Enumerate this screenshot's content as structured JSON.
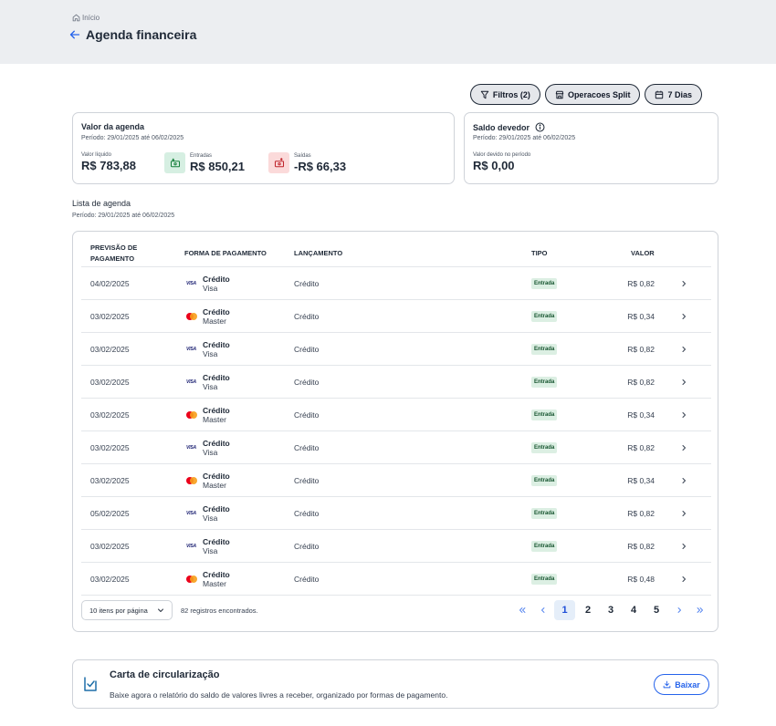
{
  "breadcrumb": {
    "label": "Início",
    "icon": "home-icon"
  },
  "page": {
    "title": "Agenda financeira"
  },
  "toolbar": {
    "filters_label": "Filtros (2)",
    "split_label": "Operacoes Split",
    "days_label": "7 Dias"
  },
  "agenda_card": {
    "title": "Valor da agenda",
    "period": "Período: 29/01/2025 até 06/02/2025",
    "liquido_label": "Valor líquido",
    "liquido_value": "R$ 783,88",
    "entradas_label": "Entradas",
    "entradas_value": "R$ 850,21",
    "saidas_label": "Saídas",
    "saidas_value": "-R$ 66,33"
  },
  "saldo_card": {
    "title": "Saldo devedor",
    "period": "Período: 29/01/2025 até 06/02/2025",
    "devido_label": "Valor devido no período",
    "devido_value": "R$ 0,00"
  },
  "list": {
    "title": "Lista de agenda",
    "period": "Período: 29/01/2025 até 06/02/2025"
  },
  "table": {
    "headers": {
      "previsao_1": "PREVISÃO DE",
      "previsao_2": "PAGAMENTO",
      "forma": "FORMA DE PAGAMENTO",
      "lancamento": "LANÇAMENTO",
      "tipo": "TIPO",
      "valor": "VALOR"
    },
    "rows": [
      {
        "date": "04/02/2025",
        "method": "Crédito",
        "brand": "Visa",
        "lancamento": "Crédito",
        "tipo": "Entrada",
        "valor": "R$ 0,82"
      },
      {
        "date": "03/02/2025",
        "method": "Crédito",
        "brand": "Master",
        "lancamento": "Crédito",
        "tipo": "Entrada",
        "valor": "R$ 0,34"
      },
      {
        "date": "03/02/2025",
        "method": "Crédito",
        "brand": "Visa",
        "lancamento": "Crédito",
        "tipo": "Entrada",
        "valor": "R$ 0,82"
      },
      {
        "date": "03/02/2025",
        "method": "Crédito",
        "brand": "Visa",
        "lancamento": "Crédito",
        "tipo": "Entrada",
        "valor": "R$ 0,82"
      },
      {
        "date": "03/02/2025",
        "method": "Crédito",
        "brand": "Master",
        "lancamento": "Crédito",
        "tipo": "Entrada",
        "valor": "R$ 0,34"
      },
      {
        "date": "03/02/2025",
        "method": "Crédito",
        "brand": "Visa",
        "lancamento": "Crédito",
        "tipo": "Entrada",
        "valor": "R$ 0,82"
      },
      {
        "date": "03/02/2025",
        "method": "Crédito",
        "brand": "Master",
        "lancamento": "Crédito",
        "tipo": "Entrada",
        "valor": "R$ 0,34"
      },
      {
        "date": "05/02/2025",
        "method": "Crédito",
        "brand": "Visa",
        "lancamento": "Crédito",
        "tipo": "Entrada",
        "valor": "R$ 0,82"
      },
      {
        "date": "03/02/2025",
        "method": "Crédito",
        "brand": "Visa",
        "lancamento": "Crédito",
        "tipo": "Entrada",
        "valor": "R$ 0,82"
      },
      {
        "date": "03/02/2025",
        "method": "Crédito",
        "brand": "Master",
        "lancamento": "Crédito",
        "tipo": "Entrada",
        "valor": "R$ 0,48"
      }
    ]
  },
  "pagination": {
    "per_page_label": "10 itens por página",
    "records_label": "82 registros encontrados.",
    "pages": [
      "1",
      "2",
      "3",
      "4",
      "5"
    ],
    "current_page": "1"
  },
  "carta": {
    "title": "Carta de circularização",
    "description": "Baixe agora o relatório do saldo de valores livres a receber, organizado por formas de pagamento.",
    "button_label": "Baixar"
  },
  "brand_marks": {
    "visa": "VISA"
  },
  "colors": {
    "accent": "#2563eb",
    "entrada_badge": "#dcefe3",
    "saidas": "#c0262d",
    "entradas": "#16803c"
  }
}
